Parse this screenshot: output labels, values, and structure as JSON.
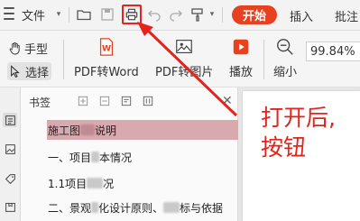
{
  "toolbar": {
    "file_label": "文件",
    "start_tab_label": "开始",
    "insert_tab_label": "插入",
    "comment_tab_label": "批注",
    "accent_color": "#e8411f",
    "highlight_color": "#e8231f",
    "icons": [
      "menu-icon",
      "open-folder-icon",
      "save-icon",
      "print-icon",
      "undo-icon",
      "redo-icon",
      "format-brush-icon"
    ]
  },
  "ribbon": {
    "hand_label": "手型",
    "select_label": "选择",
    "pdf_to_word_label": "PDF转Word",
    "pdf_to_image_label": "PDF转图片",
    "play_label": "播放",
    "zoom_out_label": "缩小",
    "zoom_value": "99.84%"
  },
  "panel": {
    "title": "书签",
    "items": [
      {
        "pre": "施工图",
        "post": "说明"
      },
      {
        "pre": "一、项目",
        "post": "本情况"
      },
      {
        "pre": "1.1项目",
        "post": "况"
      },
      {
        "pre": "二、景观",
        "post": "化设计原则、",
        "tail": "标与依据"
      }
    ]
  },
  "annotation": {
    "line1": "打开后,",
    "line2": "按钮",
    "color": "#e3231c"
  }
}
